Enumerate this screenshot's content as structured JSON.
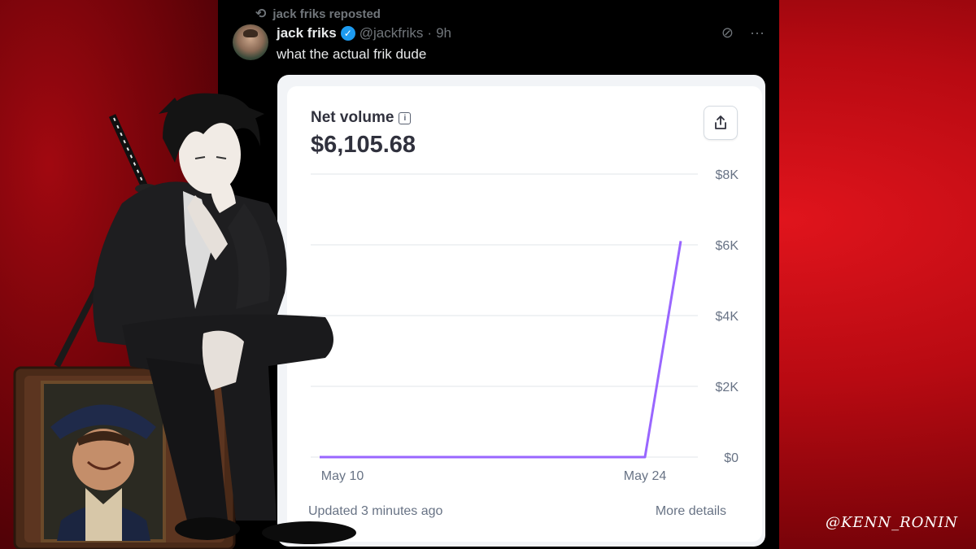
{
  "tweet": {
    "repost_label": "jack friks reposted",
    "author_name": "jack friks",
    "handle": "@jackfriks",
    "separator": "·",
    "time": "9h",
    "text": "what the actual frik dude",
    "icons": [
      "repost-icon",
      "verified-icon",
      "grok-icon",
      "more-icon"
    ]
  },
  "stripe_card": {
    "title": "Net volume",
    "value": "$6,105.68",
    "footer_left": "Updated 3 minutes ago",
    "footer_right": "More details",
    "accent_color": "#9966ff"
  },
  "chart_data": {
    "type": "line",
    "x": [
      "May 10",
      "May 24"
    ],
    "x_tick_labels": [
      "May 10",
      "May 24"
    ],
    "y_tick_labels": [
      "$8K",
      "$6K",
      "$4K",
      "$2K",
      "$0"
    ],
    "ylim": [
      0,
      8000
    ],
    "series": [
      {
        "points": [
          {
            "x": "start",
            "y": 0
          },
          {
            "x": "May 24",
            "y": 0
          },
          {
            "x": "end",
            "y": 6105.68
          }
        ]
      }
    ]
  },
  "watermark": "@KENN_RONIN"
}
